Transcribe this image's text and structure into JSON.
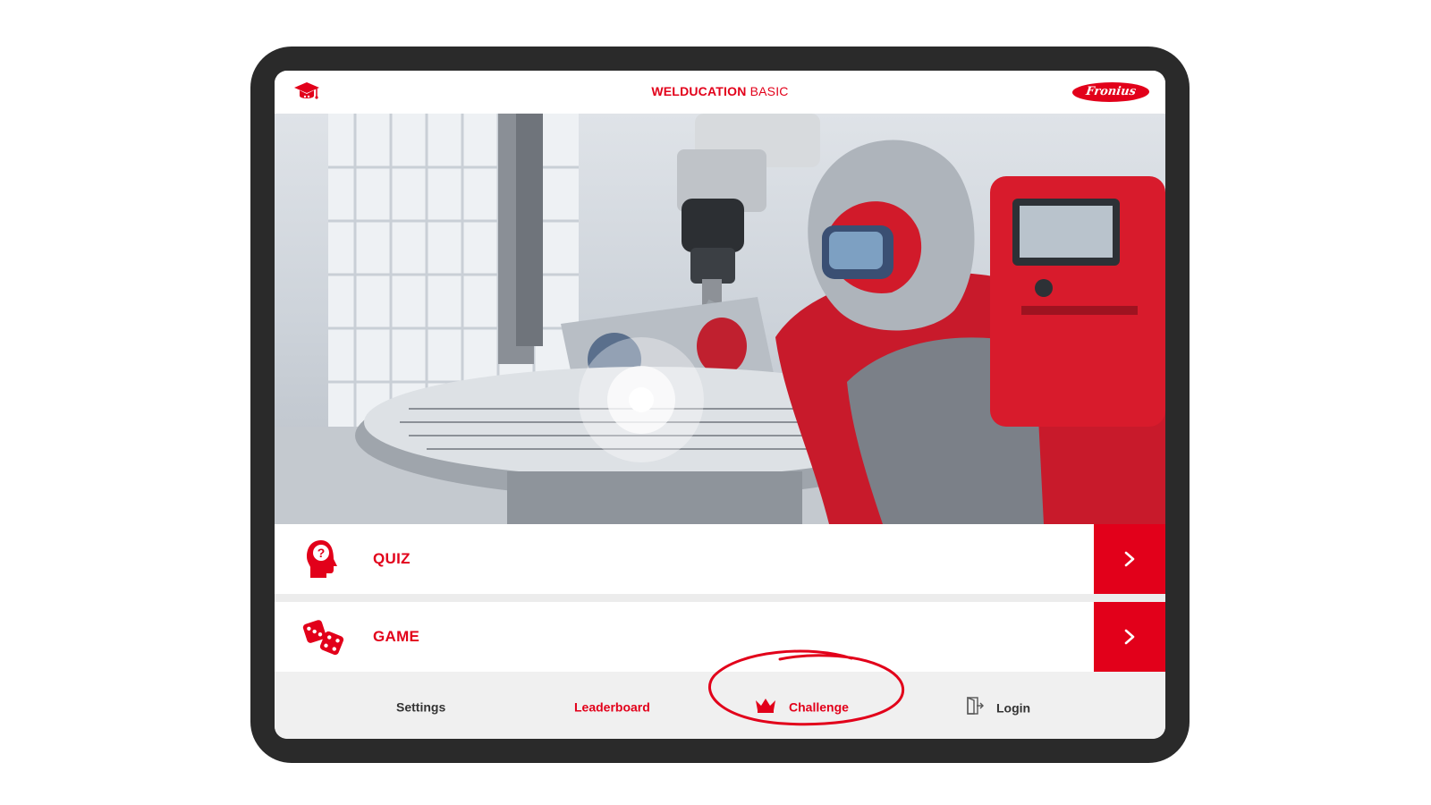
{
  "header": {
    "title_bold": "WELDUCATION",
    "title_regular": " BASIC",
    "brand_logo_text": "Fronius"
  },
  "menu": {
    "quiz_label": "QUIZ",
    "game_label": "GAME"
  },
  "nav": {
    "settings_label": "Settings",
    "leaderboard_label": "Leaderboard",
    "challenge_label": "Challenge",
    "login_label": "Login"
  },
  "icons": {
    "header_icon": "graduation-cap-icon",
    "quiz_icon": "head-question-icon",
    "game_icon": "dice-icon",
    "challenge_icon": "crown-icon",
    "login_icon": "door-icon",
    "arrow_icon": "chevron-right-icon"
  },
  "colors": {
    "accent": "#e2001a",
    "frame": "#2a2a2a",
    "nav_bg": "#f0f0f0",
    "text_dark": "#333333"
  },
  "annotation": {
    "highlighted_item": "Challenge"
  }
}
